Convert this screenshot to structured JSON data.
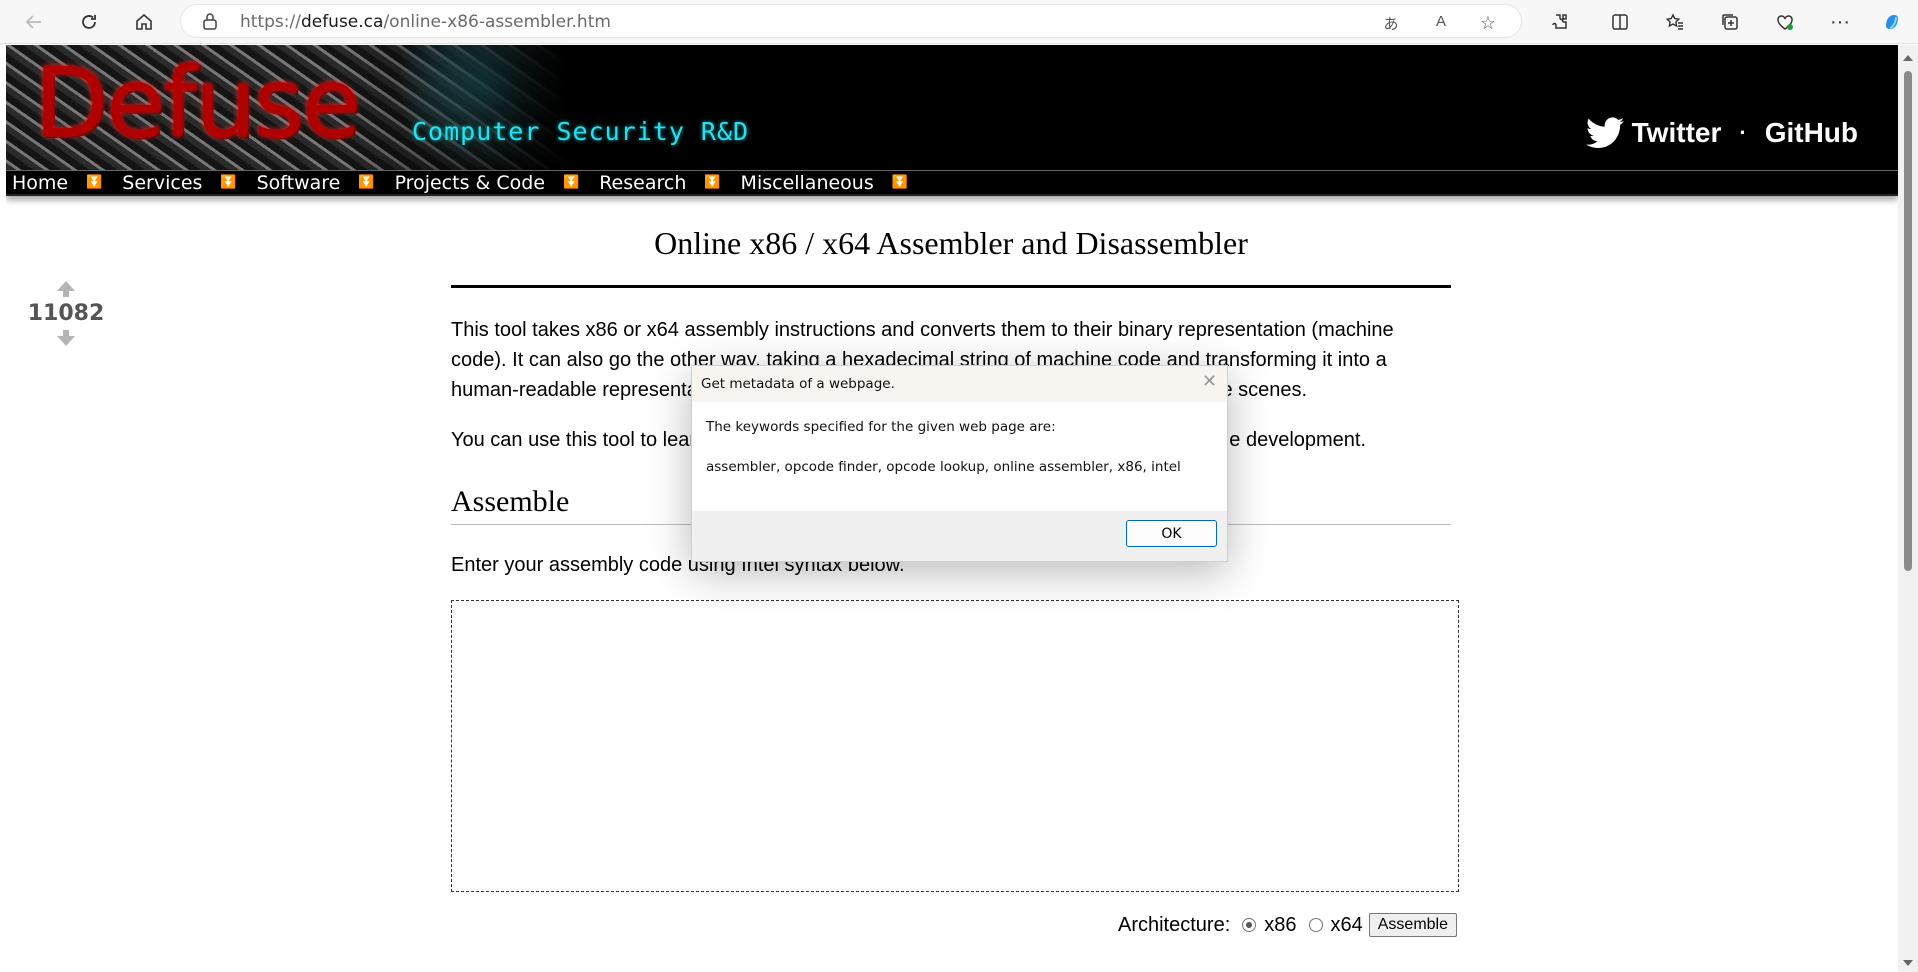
{
  "browser": {
    "url_prefix": "https://",
    "url_domain": "defuse.ca",
    "url_path": "/online-x86-assembler.htm"
  },
  "site": {
    "logo": "Defuse",
    "tagline": "Computer Security R&D",
    "social": {
      "twitter": "Twitter",
      "separator": "·",
      "github": "GitHub"
    },
    "nav": [
      "Home",
      "Services",
      "Software",
      "Projects & Code",
      "Research",
      "Miscellaneous"
    ]
  },
  "vote": {
    "count": "11082"
  },
  "content": {
    "title": "Online x86 / x64 Assembler and Disassembler",
    "p1": "This tool takes x86 or x64 assembly instructions and converts them to their binary representation (machine code). It can also go the other way, taking a hexadecimal string of machine code and transforming it into a human-readable representation of the instructions. It uses GCC and objdump behind the scenes.",
    "p2": "You can use this tool to learn x86 assembly, and as a handy tool for exploit and shellcode development.",
    "assemble_heading": "Assemble",
    "assemble_instructions": "Enter your assembly code using Intel syntax below.",
    "arch_label": "Architecture:",
    "arch_options": [
      "x86",
      "x64"
    ],
    "arch_selected": "x86",
    "assemble_button": "Assemble"
  },
  "dialog": {
    "title": "Get metadata of a webpage.",
    "message": "The keywords specified for the given web page are:",
    "keywords": "assembler, opcode finder, opcode lookup, online assembler, x86, intel",
    "ok": "OK",
    "close": "✕"
  }
}
